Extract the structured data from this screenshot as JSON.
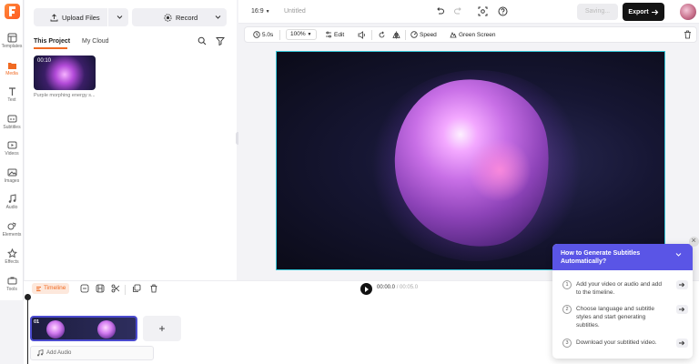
{
  "nav": {
    "items": [
      {
        "label": "Templates"
      },
      {
        "label": "Media"
      },
      {
        "label": "Text"
      },
      {
        "label": "Subtitles"
      },
      {
        "label": "Videos"
      },
      {
        "label": "Images"
      },
      {
        "label": "Audio"
      },
      {
        "label": "Elements"
      },
      {
        "label": "Effects"
      },
      {
        "label": "Tools"
      }
    ],
    "active": "Media"
  },
  "media_panel": {
    "upload_label": "Upload Files",
    "record_label": "Record",
    "tabs": [
      {
        "label": "This Project",
        "active": true
      },
      {
        "label": "My Cloud",
        "active": false
      }
    ],
    "asset": {
      "duration": "00:10",
      "caption": "Purple morphing energy s..."
    }
  },
  "topbar": {
    "aspect_ratio": "16:9",
    "project_title": "Untitled",
    "saving_label": "Saving...",
    "export_label": "Export"
  },
  "editor_toolbar": {
    "duration": "5.0s",
    "zoom": "100%",
    "edit_label": "Edit",
    "speed_label": "Speed",
    "green_screen_label": "Green Screen"
  },
  "playback": {
    "timeline_label": "Timeline",
    "current_time": "00:00.0",
    "total_time": "/ 00:05.0"
  },
  "timeline": {
    "clip_number": "01",
    "add_clip_label": "+",
    "add_audio_label": "Add Audio"
  },
  "help": {
    "title": "How to Generate Subtitles Automatically?",
    "steps": [
      {
        "num": "1",
        "text": "Add your video or audio and add to the timeline."
      },
      {
        "num": "2",
        "text": "Choose language and subtitle styles and start generating subtitles."
      },
      {
        "num": "3",
        "text": "Download your subtitled video."
      }
    ]
  },
  "colors": {
    "accent": "#f06a22",
    "help_header": "#5a55e6",
    "selection": "#35c6d8",
    "export_bg": "#141414"
  }
}
